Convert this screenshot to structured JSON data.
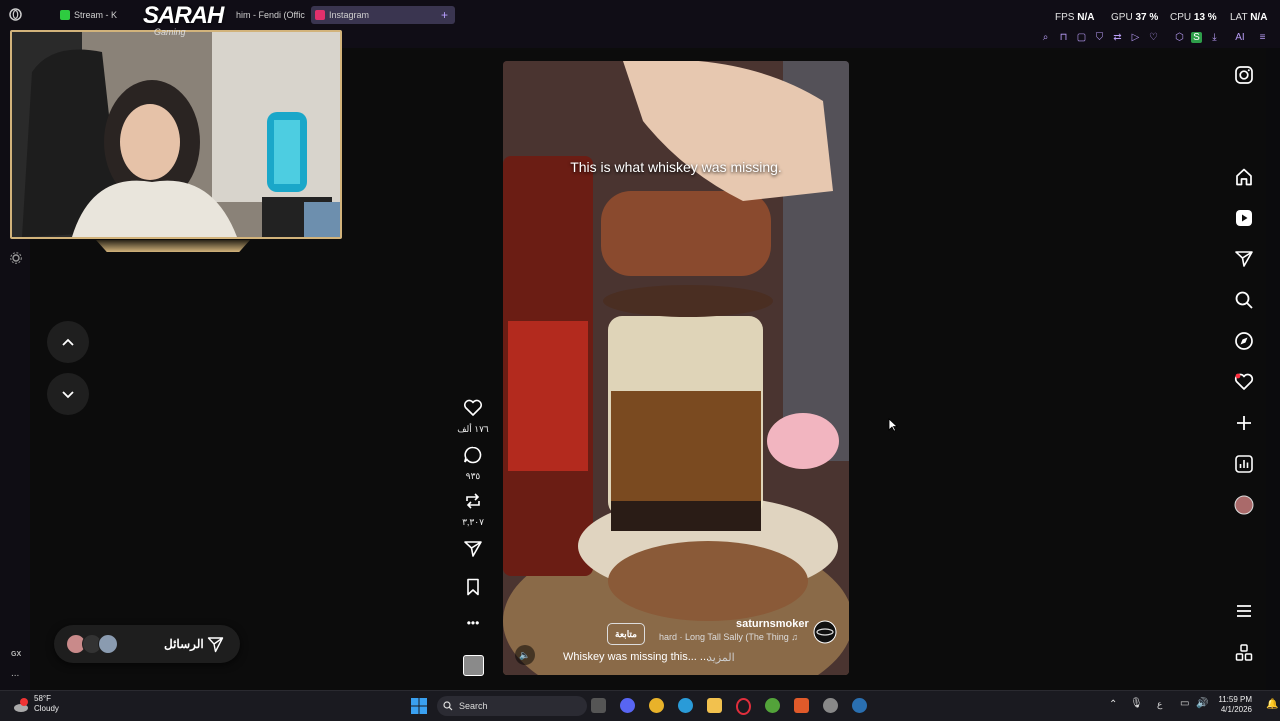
{
  "browser": {
    "tabs": [
      {
        "label": "Stream - K",
        "color": "#2ecc40"
      },
      {
        "label": "him - Fendi (Offic",
        "color": "#c0392b"
      },
      {
        "label": "Instagram",
        "color": "#e1306c"
      }
    ],
    "new_tab": "+",
    "hud": {
      "fps_label": "FPS",
      "fps_value": "N/A",
      "gpu_label": "GPU",
      "gpu_value": "37 %",
      "cpu_label": "CPU",
      "cpu_value": "13 %",
      "lat_label": "LAT",
      "lat_value": "N/A"
    },
    "toolbar_ai_label": "AI"
  },
  "overlay": {
    "logo_title": "SARAH",
    "logo_sub": "Gaming"
  },
  "messages": {
    "label": "الرسائل"
  },
  "video": {
    "caption": "This is what whiskey was missing.",
    "username": "saturnsmoker",
    "music": "hard · Long Tall Sally (The Thing",
    "follow_label": "متابعة",
    "description": "Whiskey was missing this... ...",
    "more_label": "المزيد"
  },
  "actions": {
    "likes": "١٧٦ ألف",
    "comments": "٩٣٥",
    "reposts": "٣,٣٠٧"
  },
  "gx": {
    "label": "GX",
    "more": "..."
  },
  "taskbar": {
    "weather_temp": "58°F",
    "weather_desc": "Cloudy",
    "search_placeholder": "Search",
    "time": "11:59 PM",
    "date": "4/1/2026",
    "lang": "ع"
  },
  "colors": {
    "accent": "#b89cf5",
    "frame_gold": "#d2b37b",
    "notify_red": "#ff3040"
  }
}
